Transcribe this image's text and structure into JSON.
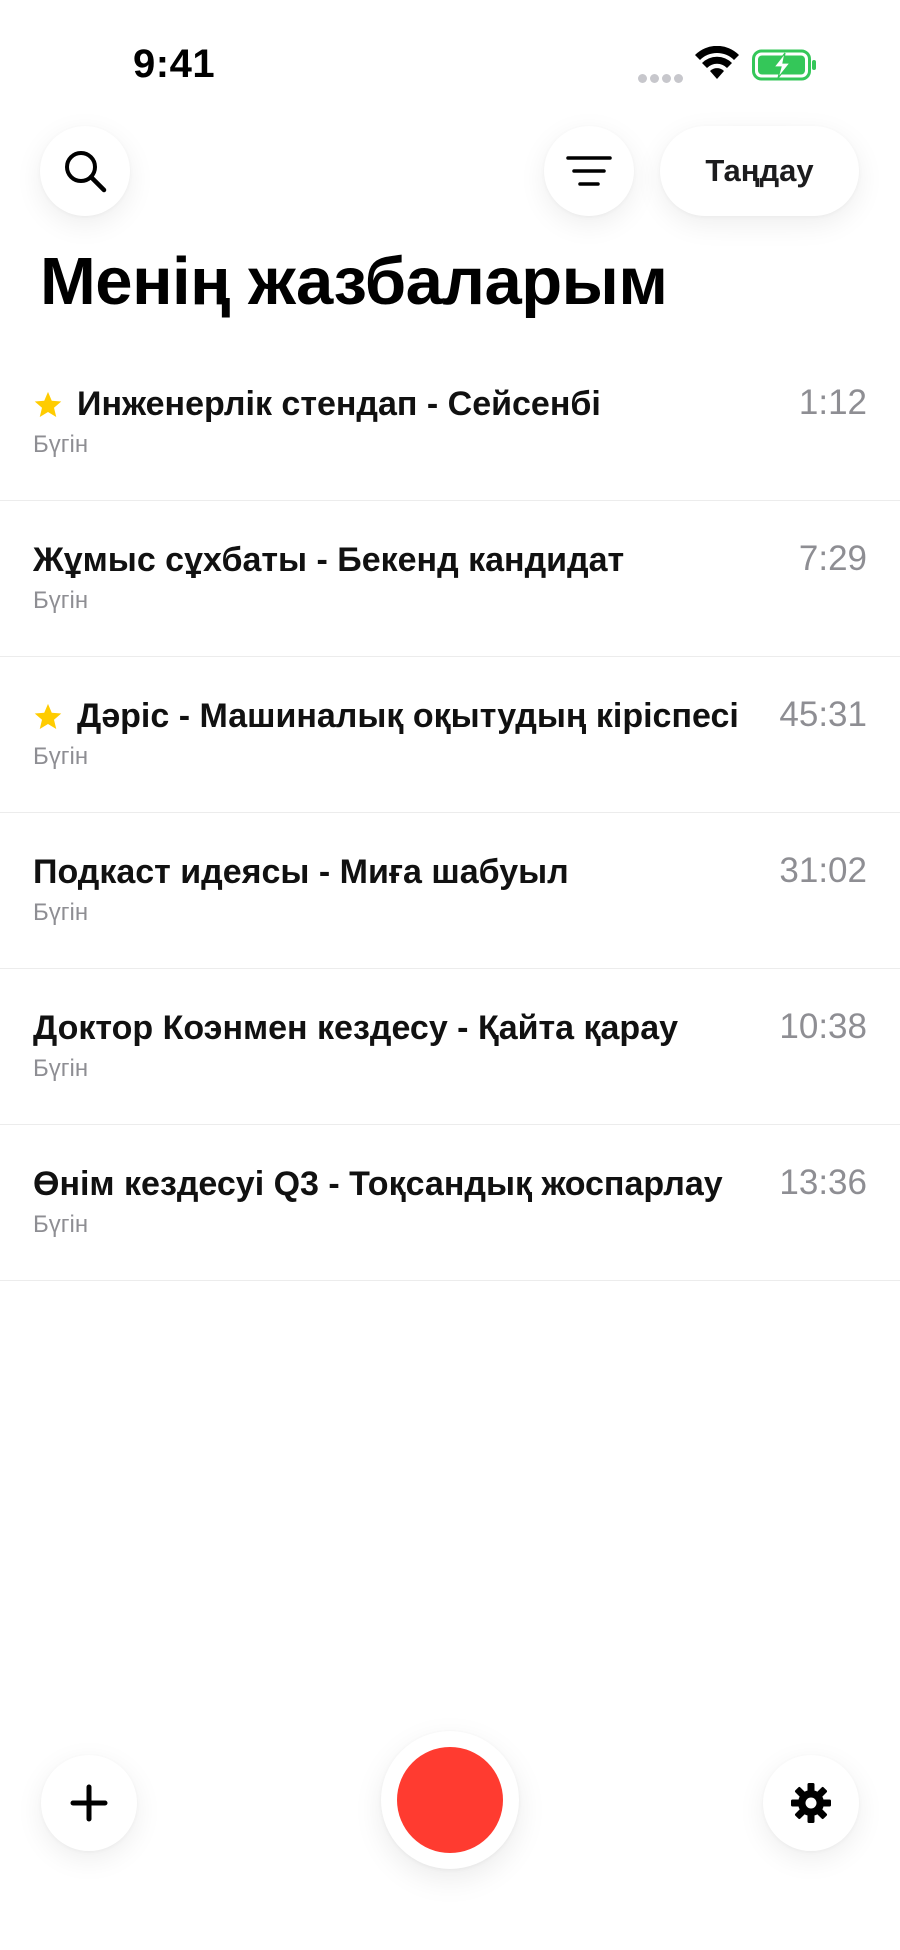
{
  "status_bar": {
    "time": "9:41",
    "icons": [
      "signal-dots-icon",
      "wifi-icon",
      "battery-charging-icon"
    ],
    "battery_color": "#34c759"
  },
  "toolbar": {
    "search_icon": "search-icon",
    "filter_icon": "filter-lines-icon",
    "select_label": "Таңдау"
  },
  "page_title": "Менің жазбаларым",
  "recordings": [
    {
      "title": "Инженерлік стендап - Сейсенбі",
      "date": "Бүгін",
      "duration": "1:12",
      "starred": true
    },
    {
      "title": "Жұмыс сұхбаты - Бекенд кандидат",
      "date": "Бүгін",
      "duration": "7:29",
      "starred": false
    },
    {
      "title": "Дәріс - Машиналық оқытудың кіріспесі",
      "date": "Бүгін",
      "duration": "45:31",
      "starred": true
    },
    {
      "title": "Подкаст идеясы - Миға шабуыл",
      "date": "Бүгін",
      "duration": "31:02",
      "starred": false
    },
    {
      "title": "Доктор Коэнмен кездесу - Қайта қарау",
      "date": "Бүгін",
      "duration": "10:38",
      "starred": false
    },
    {
      "title": "Өнім кездесуі Q3 - Тоқсандық жоспарлау",
      "date": "Бүгін",
      "duration": "13:36",
      "starred": false
    }
  ],
  "bottom_bar": {
    "add_icon": "plus-icon",
    "record_icon": "record-icon",
    "settings_icon": "gear-icon"
  },
  "colors": {
    "star": "#ffcc00",
    "record": "#ff3b30",
    "secondary_text": "#8e8e93"
  }
}
